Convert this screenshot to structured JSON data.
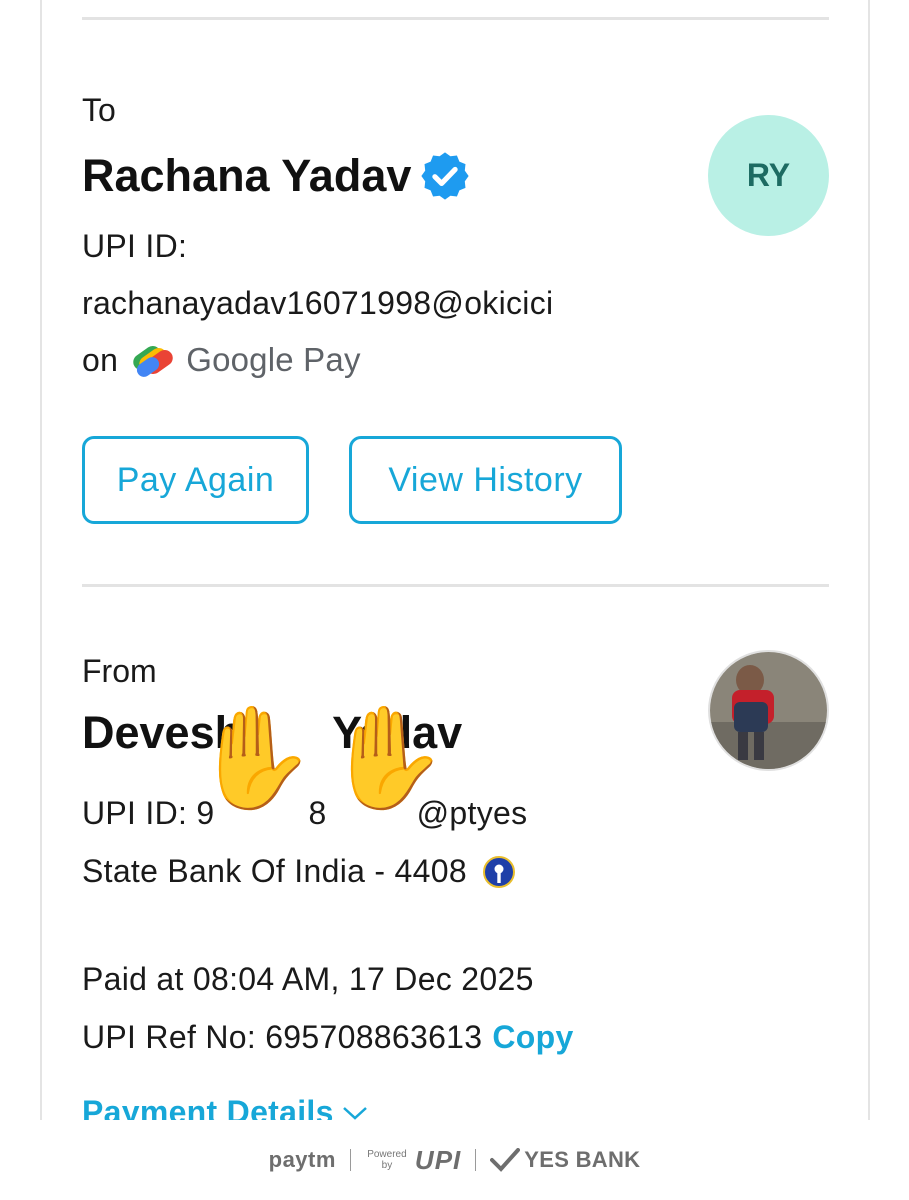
{
  "to": {
    "label": "To",
    "name": "Rachana Yadav",
    "initials": "RY",
    "upi_label": "UPI ID:",
    "upi_id": "rachanayadav16071998@okicici",
    "on_label": "on",
    "app_name": "Google Pay"
  },
  "actions": {
    "pay_again": "Pay Again",
    "view_history": "View History"
  },
  "from": {
    "label": "From",
    "name_visible_start": "Devesh",
    "name_visible_end": "Yadav",
    "upi_prefix": "UPI ID: 9",
    "upi_middle": "8",
    "upi_suffix": "@ptyes",
    "bank": "State Bank Of India - 4408"
  },
  "details": {
    "paid_at": "Paid at 08:04 AM, 17 Dec 2025",
    "ref_label": "UPI Ref No: 695708863613",
    "copy": "Copy",
    "payment_details": "Payment Details"
  },
  "footer": {
    "paytm": "paytm",
    "powered_by": "Powered by",
    "upi": "UPI",
    "yes_bank": "YES BANK"
  },
  "colors": {
    "accent": "#17a7d8",
    "avatar_bg": "#b9f0e5",
    "avatar_text": "#1d6b62",
    "verified": "#1e9bf0"
  },
  "icons": {
    "verified": "verified-badge-icon",
    "gpay": "google-pay-logo-icon",
    "sbi": "sbi-logo-icon",
    "chevron": "chevron-down-icon",
    "emoji": "raised-hands-emoji"
  }
}
